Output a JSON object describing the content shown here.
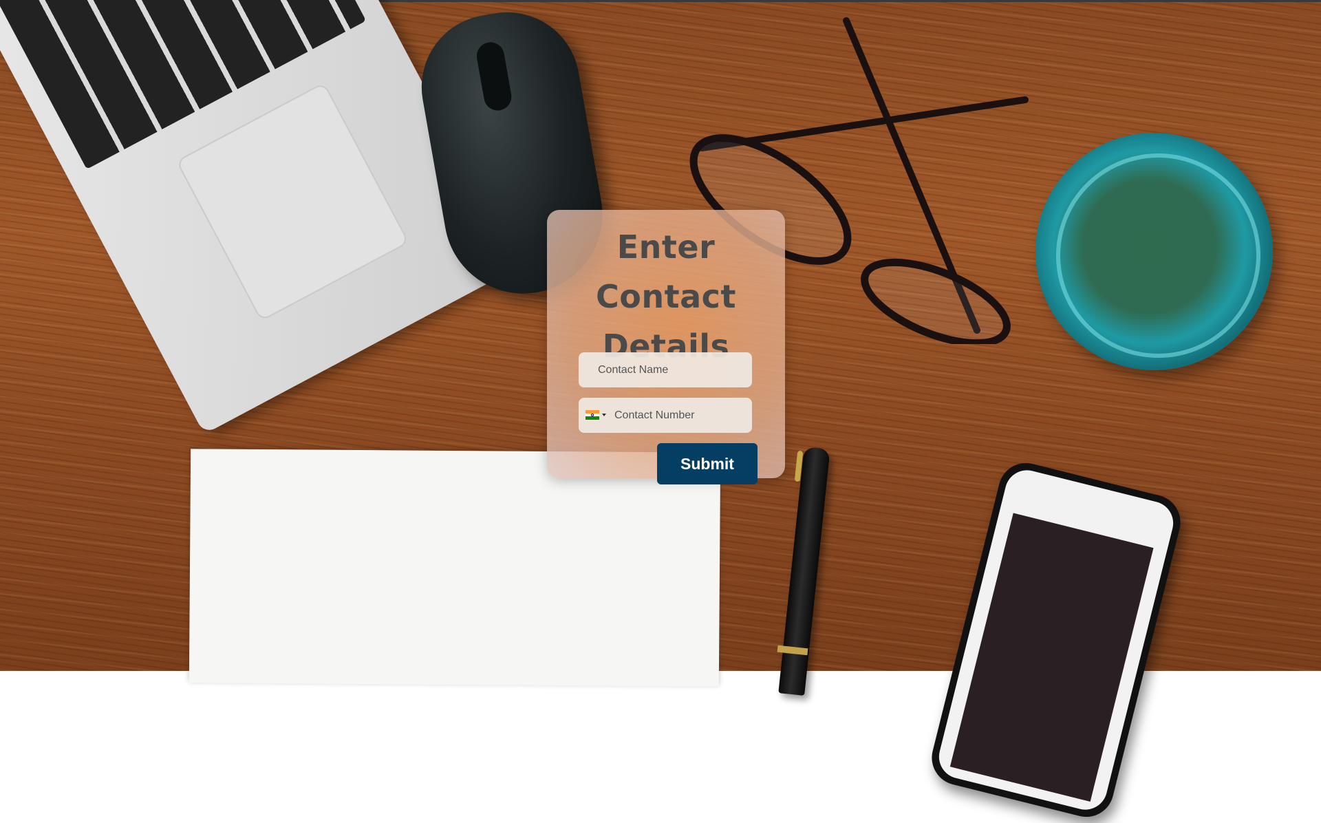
{
  "form": {
    "title": "Enter Contact Details",
    "name_field": {
      "placeholder": "Contact Name",
      "value": ""
    },
    "phone_field": {
      "placeholder": "Contact Number",
      "value": "",
      "country_flag_icon": "india-flag-icon",
      "dropdown_icon": "caret-down-icon"
    },
    "submit_label": "Submit"
  },
  "colors": {
    "title": "#4a4a4a",
    "submit_bg": "#053e63",
    "submit_text": "#ffffff",
    "field_bg": "#f0e8e2"
  },
  "background": {
    "scene": "desk-with-laptop-mouse-glasses-cup-paper-pen-phone"
  }
}
